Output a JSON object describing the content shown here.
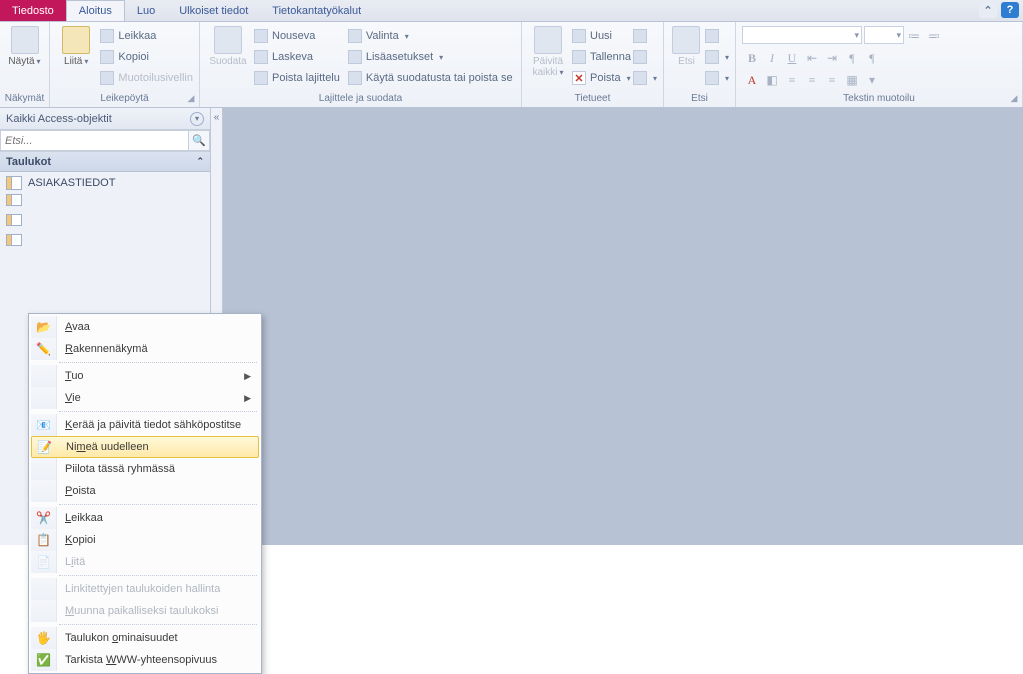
{
  "menu": {
    "file": "Tiedosto",
    "tabs": [
      "Aloitus",
      "Luo",
      "Ulkoiset tiedot",
      "Tietokantatyökalut"
    ]
  },
  "ribbon": {
    "views": {
      "title": "Näkymät",
      "btn": "Näytä"
    },
    "clipboard": {
      "title": "Leikepöytä",
      "paste": "Liitä",
      "cut": "Leikkaa",
      "copy": "Kopioi",
      "format_painter": "Muotoilusivellin"
    },
    "sort": {
      "title": "Lajittele ja suodata",
      "filter": "Suodata",
      "asc": "Nouseva",
      "desc": "Laskeva",
      "remove": "Poista lajittelu",
      "selection": "Valinta",
      "advanced": "Lisäasetukset",
      "toggle": "Käytä suodatusta tai poista se"
    },
    "records": {
      "title": "Tietueet",
      "refresh": "Päivitä\nkaikki",
      "new": "Uusi",
      "save": "Tallenna",
      "delete": "Poista"
    },
    "find": {
      "title": "Etsi",
      "find": "Etsi"
    },
    "text": {
      "title": "Tekstin muotoilu"
    }
  },
  "nav": {
    "header": "Kaikki Access-objektit",
    "search_placeholder": "Etsi...",
    "section": "Taulukot",
    "items": [
      "ASIAKASTIEDOT"
    ]
  },
  "context_menu": {
    "open": "Avaa",
    "design": "Rakennenäkymä",
    "import": "Tuo",
    "export": "Vie",
    "collect": "Kerää ja päivitä tiedot sähköpostitse",
    "rename": "Nimeä uudelleen",
    "hide": "Piilota tässä ryhmässä",
    "remove": "Poista",
    "cut": "Leikkaa",
    "copy": "Kopioi",
    "paste": "Liitä",
    "linked": "Linkitettyjen taulukoiden hallinta",
    "convert": "Muunna paikalliseksi taulukoksi",
    "props": "Taulukon ominaisuudet",
    "check": "Tarkista WWW-yhteensopivuus"
  }
}
